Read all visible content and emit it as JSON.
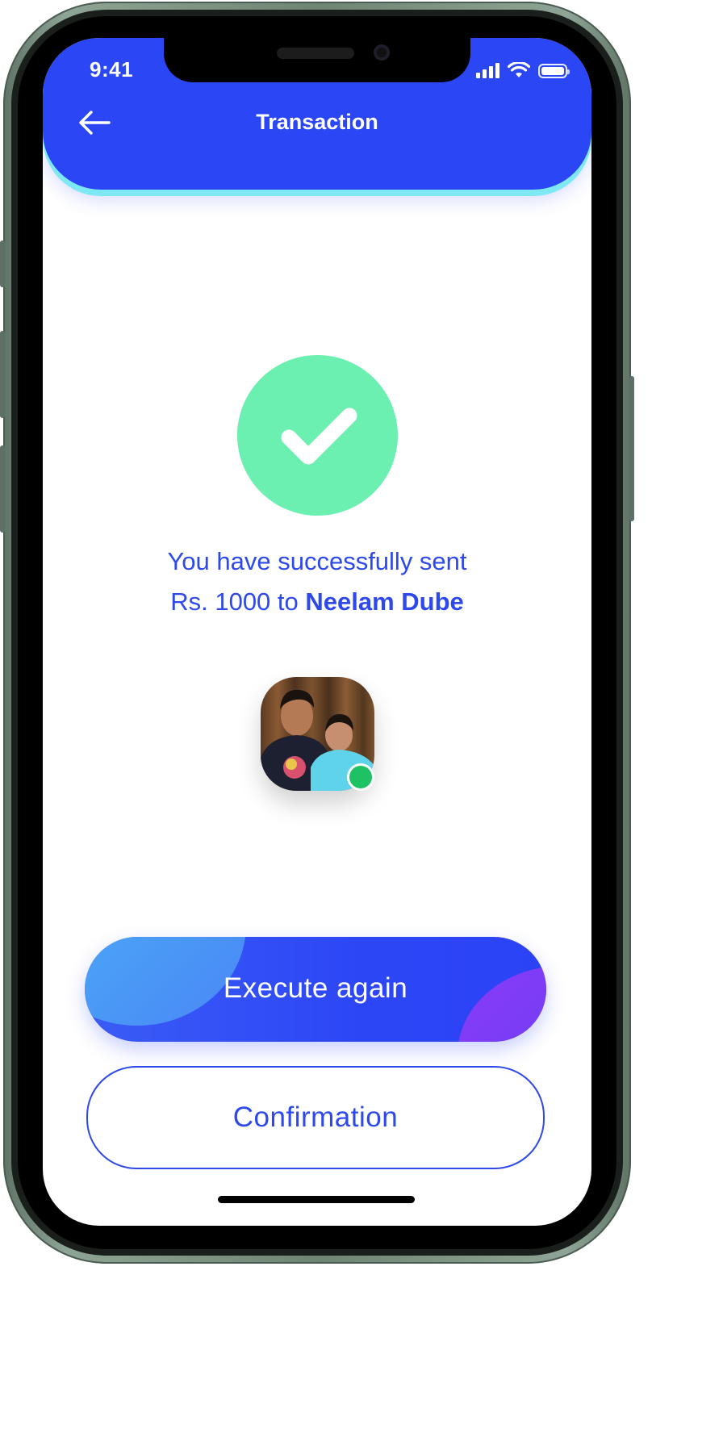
{
  "status_bar": {
    "time": "9:41"
  },
  "header": {
    "title": "Transaction"
  },
  "message": {
    "line1": "You have successfully sent",
    "line2_prefix": "Rs. 1000 to ",
    "recipient": "Neelam Dube"
  },
  "buttons": {
    "execute_again": "Execute again",
    "confirmation": "Confirmation"
  },
  "colors": {
    "brand_blue": "#2b47f5",
    "success_green": "#6cf0b1",
    "online_green": "#1ec265"
  }
}
